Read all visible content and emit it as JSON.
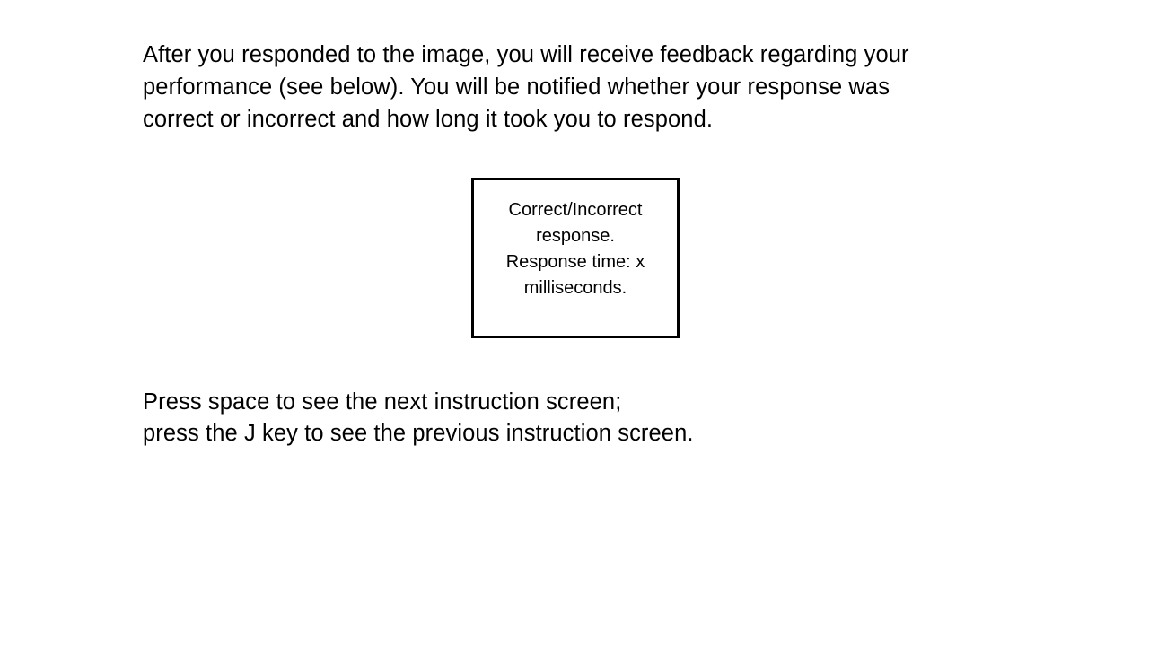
{
  "intro": {
    "lines": [
      "After you responded to the image, you will receive feedback regarding your",
      "performance (see below). You will be notified whether your response was",
      "correct or incorrect and how long it took you to respond."
    ]
  },
  "feedback_example": {
    "lines": [
      "Correct/Incorrect",
      "response.",
      "Response time: x",
      "milliseconds."
    ]
  },
  "navigation": {
    "lines": [
      "Press space to see the next instruction screen;",
      "press the J key to see the previous instruction screen."
    ]
  },
  "colors": {
    "background": "#ffffff",
    "text": "#000000",
    "box_border": "#000000"
  }
}
